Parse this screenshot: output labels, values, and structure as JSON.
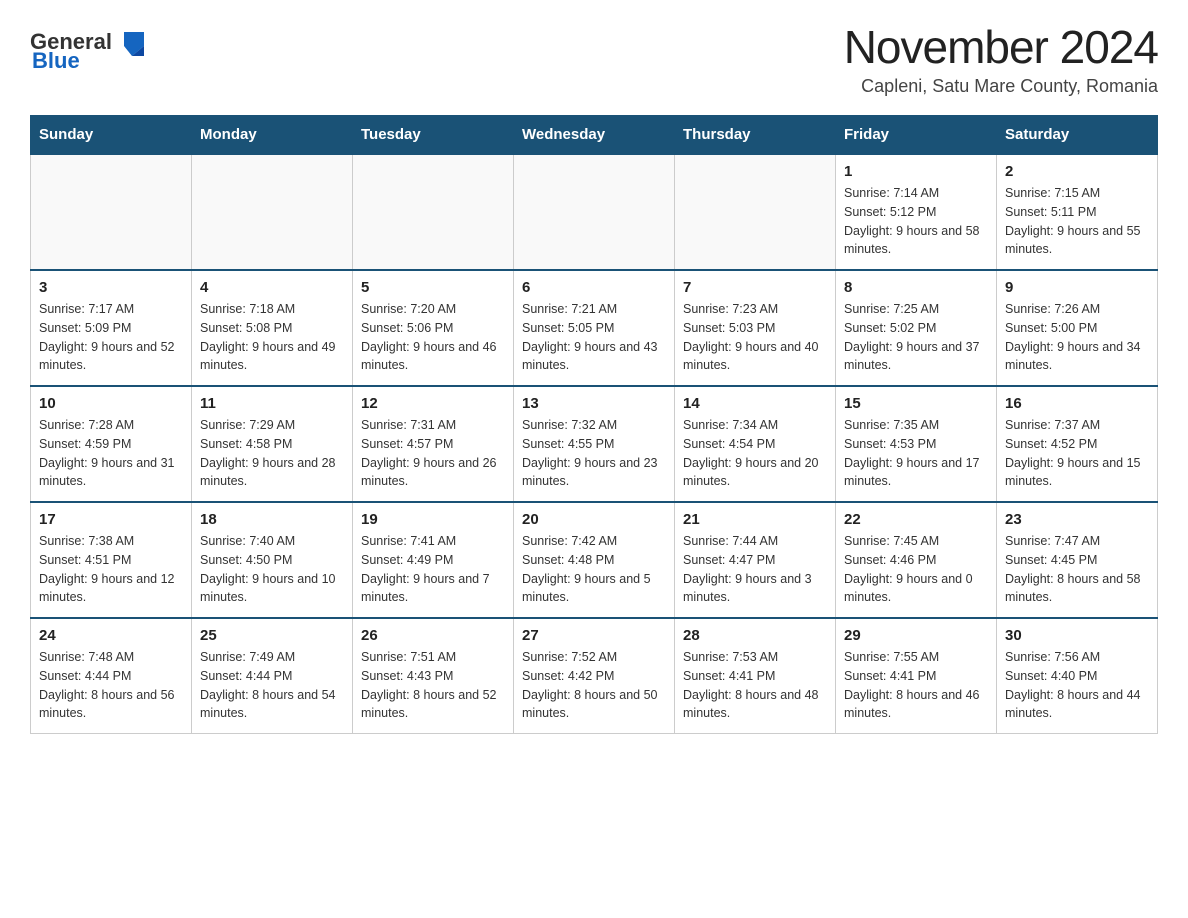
{
  "header": {
    "logo_general": "General",
    "logo_blue": "Blue",
    "month_title": "November 2024",
    "location": "Capleni, Satu Mare County, Romania"
  },
  "weekdays": [
    "Sunday",
    "Monday",
    "Tuesday",
    "Wednesday",
    "Thursday",
    "Friday",
    "Saturday"
  ],
  "weeks": [
    [
      {
        "day": "",
        "info": ""
      },
      {
        "day": "",
        "info": ""
      },
      {
        "day": "",
        "info": ""
      },
      {
        "day": "",
        "info": ""
      },
      {
        "day": "",
        "info": ""
      },
      {
        "day": "1",
        "info": "Sunrise: 7:14 AM\nSunset: 5:12 PM\nDaylight: 9 hours and 58 minutes."
      },
      {
        "day": "2",
        "info": "Sunrise: 7:15 AM\nSunset: 5:11 PM\nDaylight: 9 hours and 55 minutes."
      }
    ],
    [
      {
        "day": "3",
        "info": "Sunrise: 7:17 AM\nSunset: 5:09 PM\nDaylight: 9 hours and 52 minutes."
      },
      {
        "day": "4",
        "info": "Sunrise: 7:18 AM\nSunset: 5:08 PM\nDaylight: 9 hours and 49 minutes."
      },
      {
        "day": "5",
        "info": "Sunrise: 7:20 AM\nSunset: 5:06 PM\nDaylight: 9 hours and 46 minutes."
      },
      {
        "day": "6",
        "info": "Sunrise: 7:21 AM\nSunset: 5:05 PM\nDaylight: 9 hours and 43 minutes."
      },
      {
        "day": "7",
        "info": "Sunrise: 7:23 AM\nSunset: 5:03 PM\nDaylight: 9 hours and 40 minutes."
      },
      {
        "day": "8",
        "info": "Sunrise: 7:25 AM\nSunset: 5:02 PM\nDaylight: 9 hours and 37 minutes."
      },
      {
        "day": "9",
        "info": "Sunrise: 7:26 AM\nSunset: 5:00 PM\nDaylight: 9 hours and 34 minutes."
      }
    ],
    [
      {
        "day": "10",
        "info": "Sunrise: 7:28 AM\nSunset: 4:59 PM\nDaylight: 9 hours and 31 minutes."
      },
      {
        "day": "11",
        "info": "Sunrise: 7:29 AM\nSunset: 4:58 PM\nDaylight: 9 hours and 28 minutes."
      },
      {
        "day": "12",
        "info": "Sunrise: 7:31 AM\nSunset: 4:57 PM\nDaylight: 9 hours and 26 minutes."
      },
      {
        "day": "13",
        "info": "Sunrise: 7:32 AM\nSunset: 4:55 PM\nDaylight: 9 hours and 23 minutes."
      },
      {
        "day": "14",
        "info": "Sunrise: 7:34 AM\nSunset: 4:54 PM\nDaylight: 9 hours and 20 minutes."
      },
      {
        "day": "15",
        "info": "Sunrise: 7:35 AM\nSunset: 4:53 PM\nDaylight: 9 hours and 17 minutes."
      },
      {
        "day": "16",
        "info": "Sunrise: 7:37 AM\nSunset: 4:52 PM\nDaylight: 9 hours and 15 minutes."
      }
    ],
    [
      {
        "day": "17",
        "info": "Sunrise: 7:38 AM\nSunset: 4:51 PM\nDaylight: 9 hours and 12 minutes."
      },
      {
        "day": "18",
        "info": "Sunrise: 7:40 AM\nSunset: 4:50 PM\nDaylight: 9 hours and 10 minutes."
      },
      {
        "day": "19",
        "info": "Sunrise: 7:41 AM\nSunset: 4:49 PM\nDaylight: 9 hours and 7 minutes."
      },
      {
        "day": "20",
        "info": "Sunrise: 7:42 AM\nSunset: 4:48 PM\nDaylight: 9 hours and 5 minutes."
      },
      {
        "day": "21",
        "info": "Sunrise: 7:44 AM\nSunset: 4:47 PM\nDaylight: 9 hours and 3 minutes."
      },
      {
        "day": "22",
        "info": "Sunrise: 7:45 AM\nSunset: 4:46 PM\nDaylight: 9 hours and 0 minutes."
      },
      {
        "day": "23",
        "info": "Sunrise: 7:47 AM\nSunset: 4:45 PM\nDaylight: 8 hours and 58 minutes."
      }
    ],
    [
      {
        "day": "24",
        "info": "Sunrise: 7:48 AM\nSunset: 4:44 PM\nDaylight: 8 hours and 56 minutes."
      },
      {
        "day": "25",
        "info": "Sunrise: 7:49 AM\nSunset: 4:44 PM\nDaylight: 8 hours and 54 minutes."
      },
      {
        "day": "26",
        "info": "Sunrise: 7:51 AM\nSunset: 4:43 PM\nDaylight: 8 hours and 52 minutes."
      },
      {
        "day": "27",
        "info": "Sunrise: 7:52 AM\nSunset: 4:42 PM\nDaylight: 8 hours and 50 minutes."
      },
      {
        "day": "28",
        "info": "Sunrise: 7:53 AM\nSunset: 4:41 PM\nDaylight: 8 hours and 48 minutes."
      },
      {
        "day": "29",
        "info": "Sunrise: 7:55 AM\nSunset: 4:41 PM\nDaylight: 8 hours and 46 minutes."
      },
      {
        "day": "30",
        "info": "Sunrise: 7:56 AM\nSunset: 4:40 PM\nDaylight: 8 hours and 44 minutes."
      }
    ]
  ]
}
